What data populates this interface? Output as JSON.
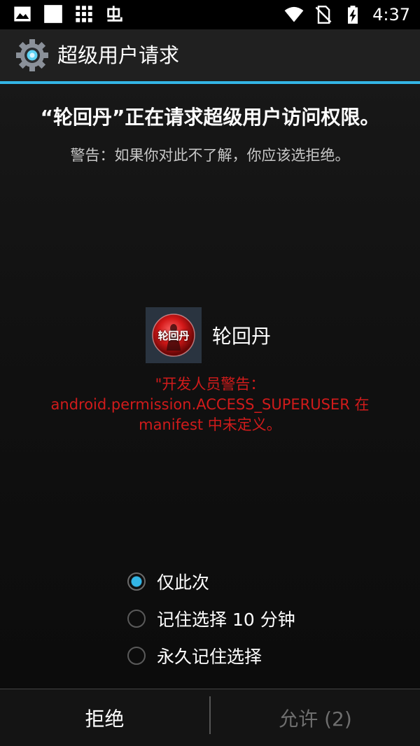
{
  "status_bar": {
    "time": "4:37",
    "left_icons": [
      "image-icon",
      "square-icon",
      "grid-icon",
      "bug-icon"
    ],
    "right_icons": [
      "wifi-icon",
      "no-sim-icon",
      "battery-charging-icon"
    ]
  },
  "title_bar": {
    "icon": "gear-icon",
    "title": "超级用户请求"
  },
  "request": {
    "headline": "“轮回丹”正在请求超级用户访问权限。",
    "warning": "警告：如果你对此不了解，你应该选拒绝。"
  },
  "app": {
    "name": "轮回丹",
    "icon_text": "轮回丹"
  },
  "dev_warning": {
    "line1": "\"开发人员警告：",
    "line2": "android.permission.ACCESS_SUPERUSER 在",
    "line3": "manifest 中未定义。"
  },
  "options": [
    {
      "label": "仅此次",
      "checked": true
    },
    {
      "label": "记住选择 10 分钟",
      "checked": false
    },
    {
      "label": "永久记住选择",
      "checked": false
    }
  ],
  "buttons": {
    "deny": "拒绝",
    "allow": "允许 (2)"
  },
  "colors": {
    "accent": "#33b5e5",
    "warning_red": "#d01b1b"
  }
}
